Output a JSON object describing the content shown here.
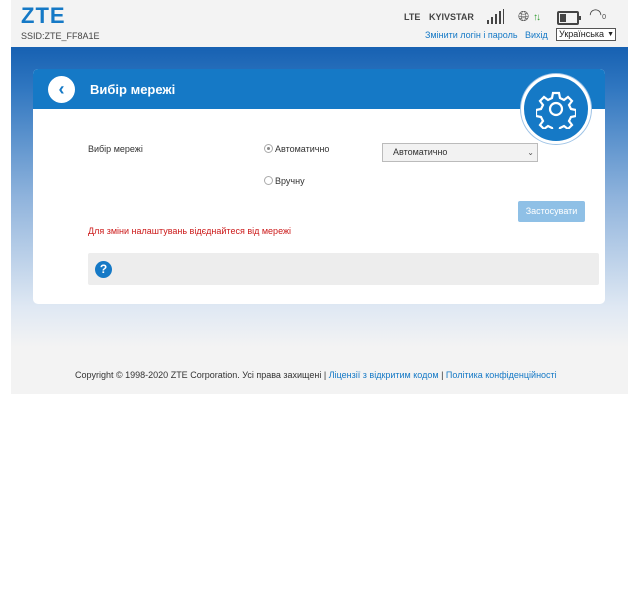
{
  "header": {
    "logo": "ZTE",
    "ssid": "SSID:ZTE_FF8A1E",
    "network_type": "LTE",
    "operator": "KYIVSTAR",
    "wifi_clients": "0",
    "change_login_link": "Змінити логін і пароль",
    "logout_link": "Вихід",
    "language_selected": "Українська",
    "status_colors": {
      "data_arrows": "#2d9a2d",
      "accent": "#1579c6"
    }
  },
  "page": {
    "title": "Вибір мережі",
    "field_label": "Вибір мережі",
    "options": {
      "auto_label": "Автоматично",
      "manual_label": "Вручну",
      "selected": "auto"
    },
    "dropdown_value": "Автоматично",
    "apply_label": "Застосувати",
    "warning": "Для зміни налаштувань відєднайтеся від мережі",
    "help_icon": "?"
  },
  "footer": {
    "copyright": "Copyright © 1998-2020 ZTE Corporation. Усі права захищені",
    "sep": "|",
    "license_link": "Ліцензії з відкритим кодом",
    "privacy_link": "Політика конфіденційності"
  }
}
